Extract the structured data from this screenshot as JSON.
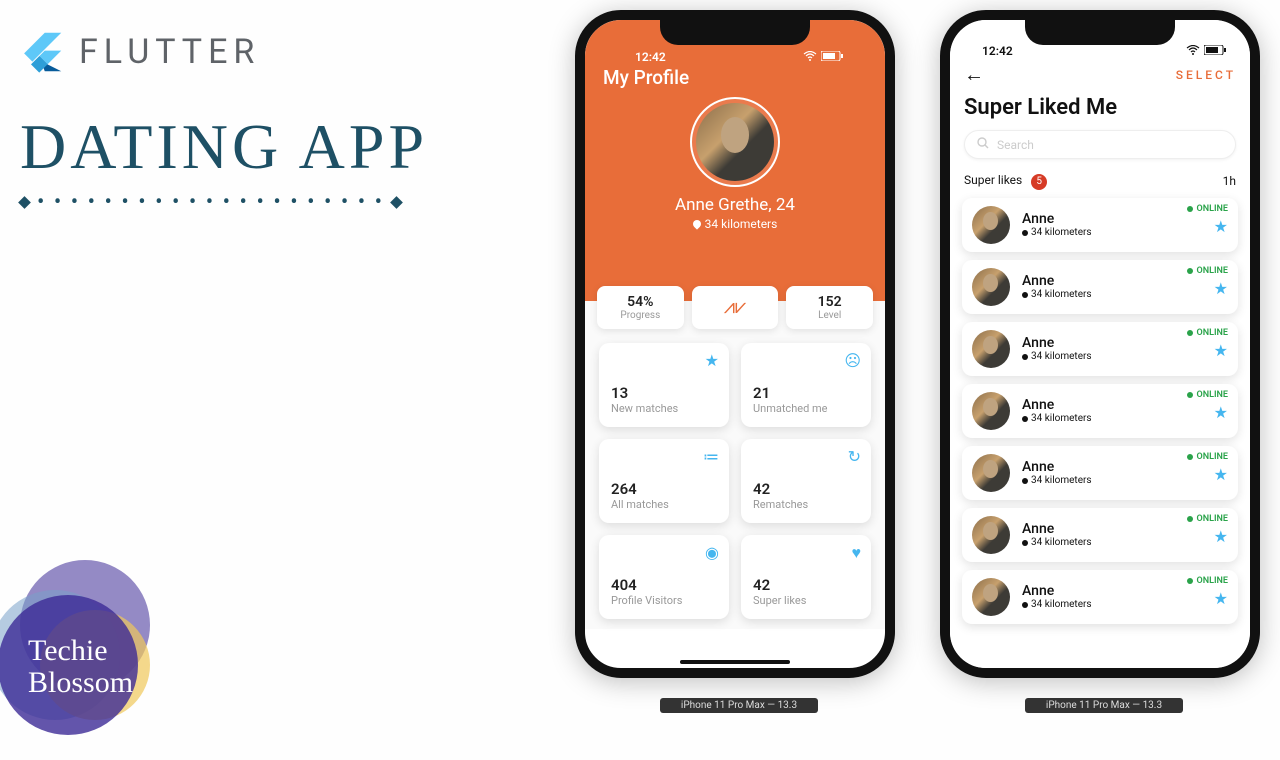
{
  "header": {
    "flutter_label": "FLUTTER",
    "title": "DATING APP"
  },
  "badge": {
    "line1": "Techie",
    "line2": "Blossom"
  },
  "device_caption": "iPhone 11 Pro Max — 13.3",
  "status": {
    "time": "12:42"
  },
  "profile": {
    "screen_title": "My Profile",
    "name": "Anne Grethe, 24",
    "distance": "34 kilometers",
    "stats": {
      "progress": {
        "value": "54%",
        "label": "Progress"
      },
      "level": {
        "value": "152",
        "label": "Level"
      }
    },
    "cards": [
      {
        "value": "13",
        "label": "New matches",
        "icon": "star-icon"
      },
      {
        "value": "21",
        "label": "Unmatched me",
        "icon": "sad-face-icon"
      },
      {
        "value": "264",
        "label": "All matches",
        "icon": "checklist-icon"
      },
      {
        "value": "42",
        "label": "Rematches",
        "icon": "refresh-icon"
      },
      {
        "value": "404",
        "label": "Profile Visitors",
        "icon": "eye-icon"
      },
      {
        "value": "42",
        "label": "Super likes",
        "icon": "heart-icon"
      }
    ]
  },
  "superliked": {
    "select_label": "SELECT",
    "title": "Super Liked Me",
    "search_placeholder": "Search",
    "meta_label": "Super likes",
    "meta_count": "5",
    "meta_time": "1h",
    "online_label": "ONLINE",
    "items": [
      {
        "name": "Anne",
        "distance": "34 kilometers"
      },
      {
        "name": "Anne",
        "distance": "34 kilometers"
      },
      {
        "name": "Anne",
        "distance": "34 kilometers"
      },
      {
        "name": "Anne",
        "distance": "34 kilometers"
      },
      {
        "name": "Anne",
        "distance": "34 kilometers"
      },
      {
        "name": "Anne",
        "distance": "34 kilometers"
      },
      {
        "name": "Anne",
        "distance": "34 kilometers"
      }
    ]
  }
}
